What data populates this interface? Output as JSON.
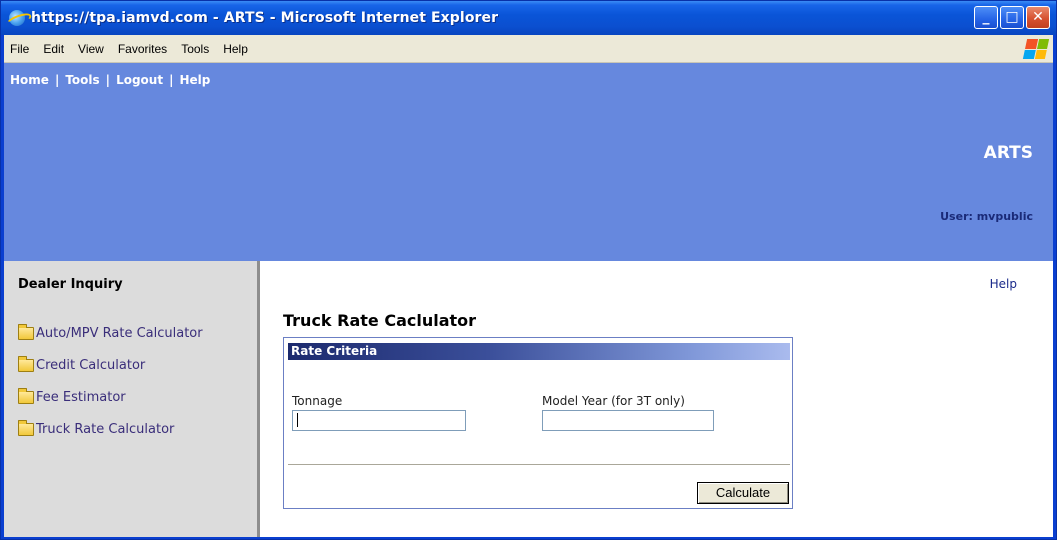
{
  "window": {
    "title": "https://tpa.iamvd.com - ARTS - Microsoft Internet Explorer",
    "buttons": {
      "minimize": "_",
      "maximize": "□",
      "close": "✕"
    }
  },
  "menubar": {
    "items": [
      "File",
      "Edit",
      "View",
      "Favorites",
      "Tools",
      "Help"
    ]
  },
  "header": {
    "nav": [
      "Home",
      "Tools",
      "Logout",
      "Help"
    ],
    "nav_separator": "|",
    "app_title": "ARTS",
    "user_label": "User: mvpublic",
    "background_color": "#6688de"
  },
  "sidebar": {
    "title": "Dealer Inquiry",
    "items": [
      {
        "label": "Auto/MPV Rate Calculator",
        "icon": "folder-icon"
      },
      {
        "label": "Credit Calculator",
        "icon": "folder-icon"
      },
      {
        "label": "Fee Estimator",
        "icon": "folder-icon"
      },
      {
        "label": "Truck Rate Calculator",
        "icon": "folder-icon"
      }
    ]
  },
  "main": {
    "help_link": "Help",
    "page_title": "Truck Rate Caclulator",
    "criteria": {
      "header": "Rate Criteria",
      "tonnage_label": "Tonnage",
      "tonnage_value": "",
      "model_year_label": "Model Year (for 3T only)",
      "model_year_value": "",
      "submit_label": "Calculate"
    }
  }
}
